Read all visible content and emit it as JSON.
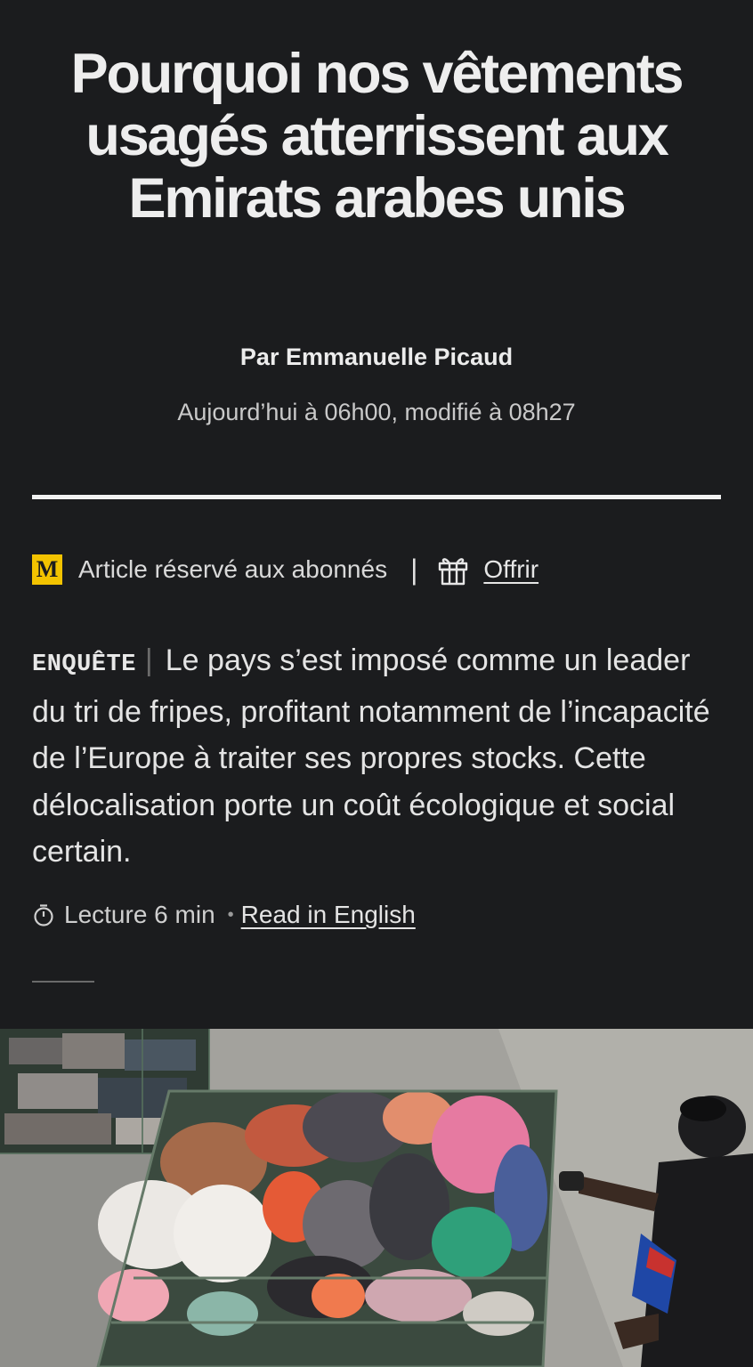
{
  "article": {
    "title": "Pourquoi nos vêtements usagés atterrissent aux Emirats arabes unis",
    "byline_prefix": "Par",
    "author": "Emmanuelle Picaud",
    "dateline": "Aujourd’hui à 06h00, modifié à 08h27",
    "subscription": {
      "logo_letter": "M",
      "label": "Article réservé aux abonnés",
      "separator": "|",
      "gift_label": "Offrir"
    },
    "kicker": "ENQUÊTE",
    "kicker_separator": "|",
    "summary": "Le pays s’est imposé comme un leader du tri de fripes, profitant notamment de l’incapacité de l’Europe à traiter ses propres stocks. Cette délocalisation porte un coût écologique et social certain.",
    "reading_time": "Lecture 6 min",
    "meta_separator": "•",
    "read_in_english": "Read in English"
  },
  "colors": {
    "background": "#1b1c1e",
    "logo_yellow": "#f3c300",
    "text": "#e8e8e8",
    "muted": "#c9c9c9"
  },
  "icons": {
    "logo": "le-monde-logo-icon",
    "gift": "gift-icon",
    "timer": "timer-icon"
  }
}
